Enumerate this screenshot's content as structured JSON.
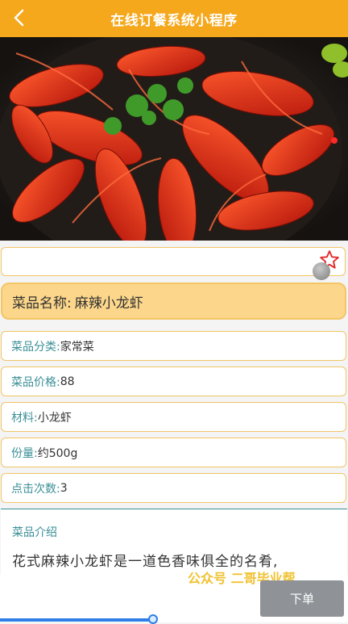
{
  "header": {
    "title": "在线订餐系统小程序"
  },
  "dish": {
    "name_label": "菜品名称:",
    "name": "麻辣小龙虾",
    "fields": [
      {
        "label": "菜品分类:",
        "value": "家常菜"
      },
      {
        "label": "菜品价格:",
        "value": "88"
      },
      {
        "label": "材料:",
        "value": "小龙虾"
      },
      {
        "label": "份量:",
        "value": "约500g"
      },
      {
        "label": "点击次数:",
        "value": "3"
      }
    ],
    "intro_title": "菜品介绍",
    "intro_text": "花式麻辣小龙虾是一道色香味俱全的名肴,"
  },
  "watermark": "公众号 二哥毕业帮",
  "order_button": "下单",
  "icons": {
    "back": "chevron-left-icon",
    "favorite": "star-outline-icon"
  },
  "colors": {
    "header": "#f5a81c",
    "label": "#3a8f96",
    "name_bg": "#fcd68a",
    "button": "#8f9397"
  }
}
